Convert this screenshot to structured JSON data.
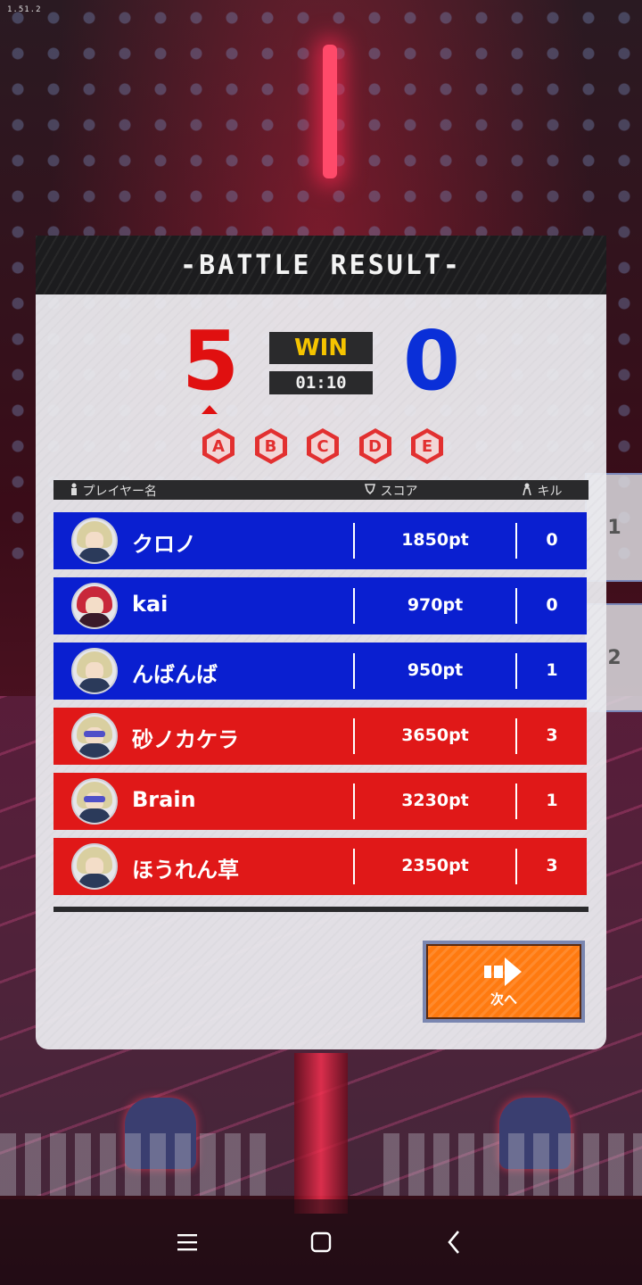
{
  "version": "1.51.2",
  "side_tabs": [
    "1",
    "2"
  ],
  "panel": {
    "title": "-BATTLE RESULT-",
    "red_score": "5",
    "blue_score": "0",
    "result": "WIN",
    "time": "01:10",
    "capture_points": [
      "A",
      "B",
      "C",
      "D",
      "E"
    ]
  },
  "table": {
    "headers": {
      "name": "プレイヤー名",
      "score": "スコア",
      "kill": "キル"
    },
    "players": [
      {
        "team": "blue",
        "name": "クロノ",
        "score": "1850pt",
        "kill": "0"
      },
      {
        "team": "blue",
        "name": "kai",
        "score": "970pt",
        "kill": "0"
      },
      {
        "team": "blue",
        "name": "んばんば",
        "score": "950pt",
        "kill": "1"
      },
      {
        "team": "red",
        "name": "砂ノカケラ",
        "score": "3650pt",
        "kill": "3"
      },
      {
        "team": "red",
        "name": "Brain",
        "score": "3230pt",
        "kill": "1"
      },
      {
        "team": "red",
        "name": "ほうれん草",
        "score": "2350pt",
        "kill": "3"
      }
    ]
  },
  "next_button": {
    "label": "次へ"
  },
  "colors": {
    "blue_team": "#0a1fd0",
    "red_team": "#e01818",
    "accent_orange": "#ff7a10",
    "win_yellow": "#f5c400"
  }
}
